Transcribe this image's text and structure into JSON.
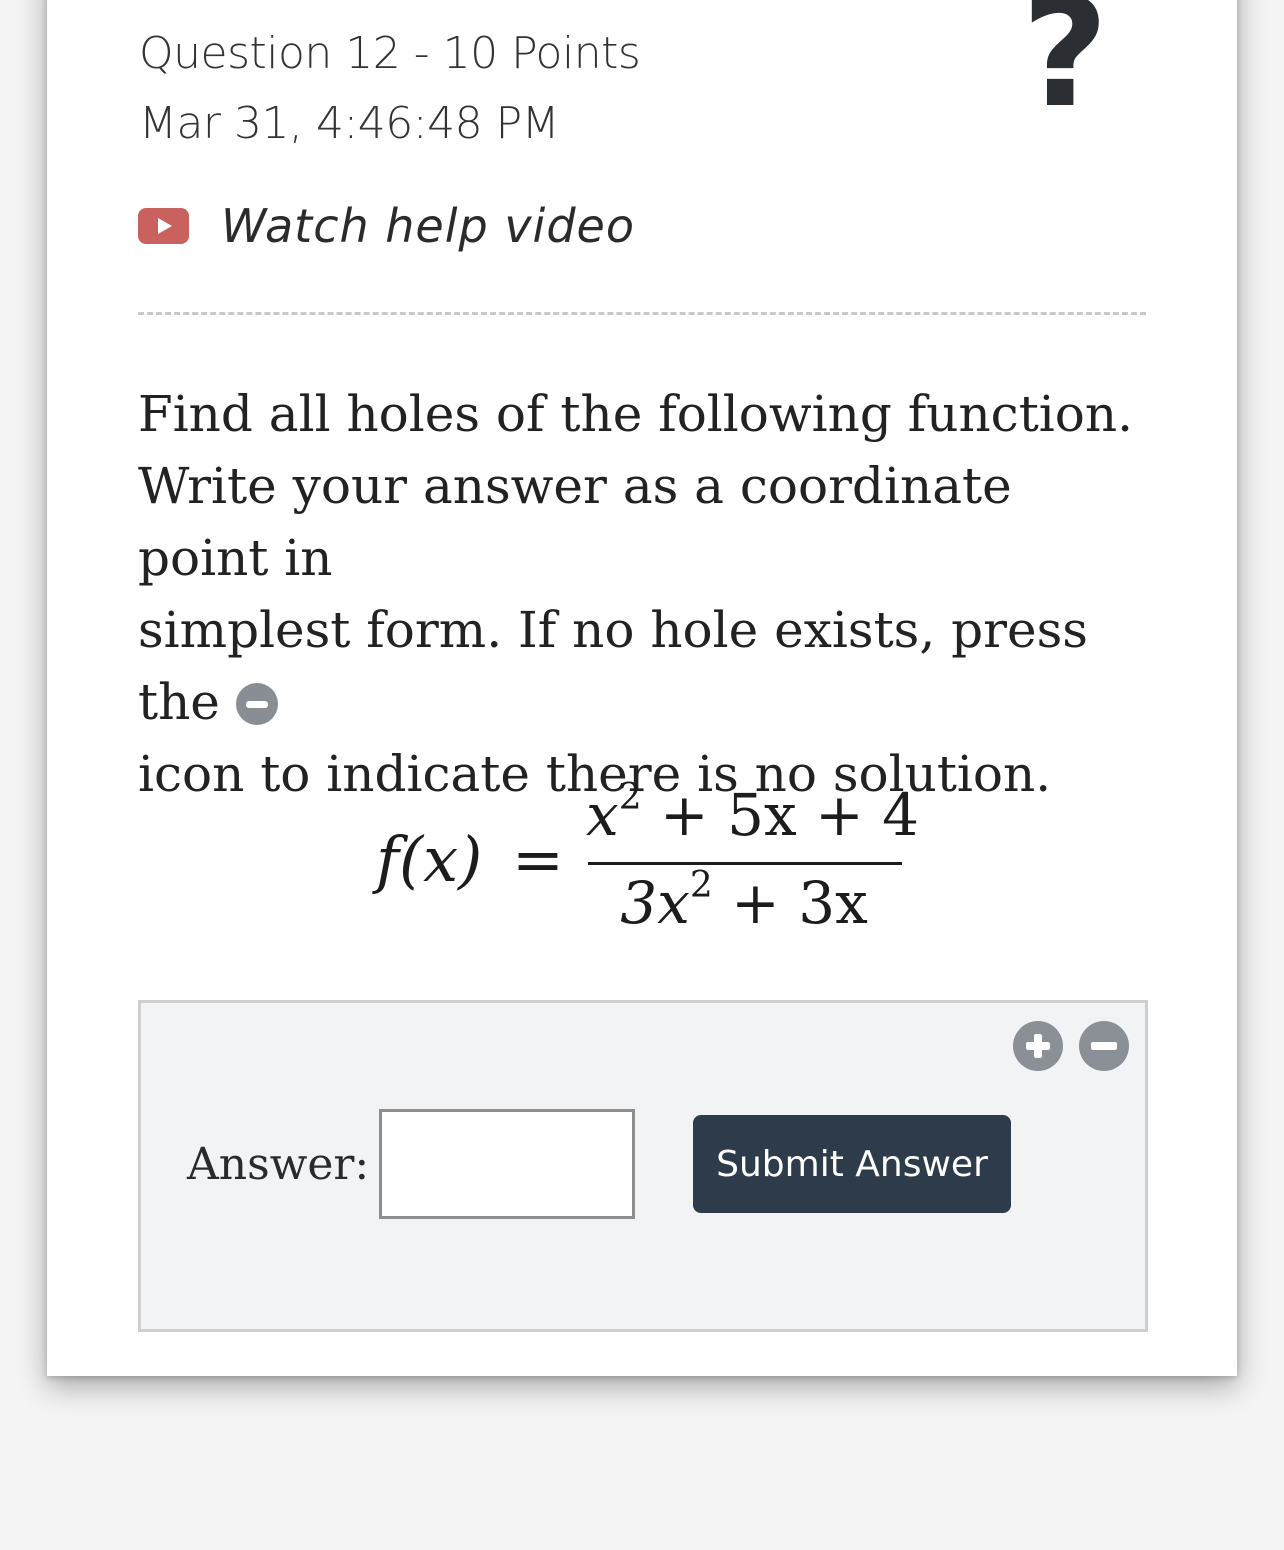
{
  "question": {
    "title": "Question 12 - 10 Points",
    "timestamp": "Mar 31, 4:46:48 PM",
    "help_icon": "question-mark-icon",
    "video_link_label": "Watch help video",
    "video_icon": "youtube-play-icon"
  },
  "prompt": {
    "line1": "Find all holes of the following function.",
    "line2": "Write your answer as a coordinate point in",
    "line3_before_icon": "simplest form. If no hole exists, press the",
    "line4": "icon to indicate there is no solution."
  },
  "formula": {
    "lhs": "f(x)",
    "equals": "=",
    "numerator_base": "x",
    "numerator_exp": "2",
    "numerator_rest": " + 5x + 4",
    "denominator_base": "3x",
    "denominator_exp": "2",
    "denominator_rest": " + 3x"
  },
  "answer": {
    "label": "Answer:",
    "input_value": "",
    "submit_label": "Submit Answer",
    "add_icon": "plus-circle-icon",
    "remove_icon": "minus-circle-icon"
  },
  "colors": {
    "submit_bg": "#2e3b4b",
    "video_icon": "#c9625e",
    "panel_bg": "#f2f3f5",
    "round_icon": "#8a9096"
  }
}
